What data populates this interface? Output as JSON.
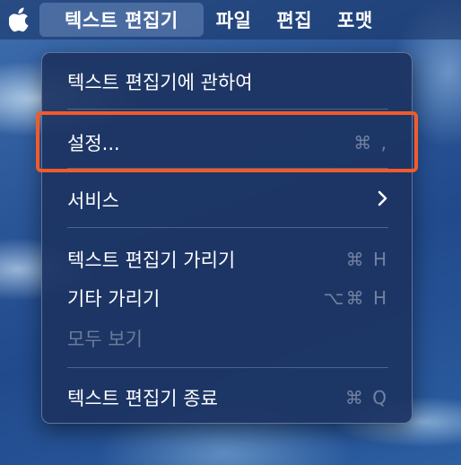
{
  "menubar": {
    "apple_icon": "apple-logo-icon",
    "items": [
      "텍스트 편집기",
      "파일",
      "편집",
      "포맷"
    ]
  },
  "menu": {
    "about": "텍스트 편집기에 관하여",
    "settings": {
      "label": "설정...",
      "shortcut": "⌘ ,"
    },
    "services": {
      "label": "서비스",
      "submenu_icon": "chevron-right-icon",
      "arrow": "›"
    },
    "hide_app": {
      "label": "텍스트 편집기 가리기",
      "shortcut": "⌘ H"
    },
    "hide_others": {
      "label": "기타 가리기",
      "shortcut": "⌥⌘ H"
    },
    "show_all": {
      "label": "모두 보기",
      "disabled": true
    },
    "quit": {
      "label": "텍스트 편집기 종료",
      "shortcut": "⌘ Q"
    }
  },
  "colors": {
    "highlight_outline": "#f25a2a",
    "menu_background": "#1c3462"
  }
}
